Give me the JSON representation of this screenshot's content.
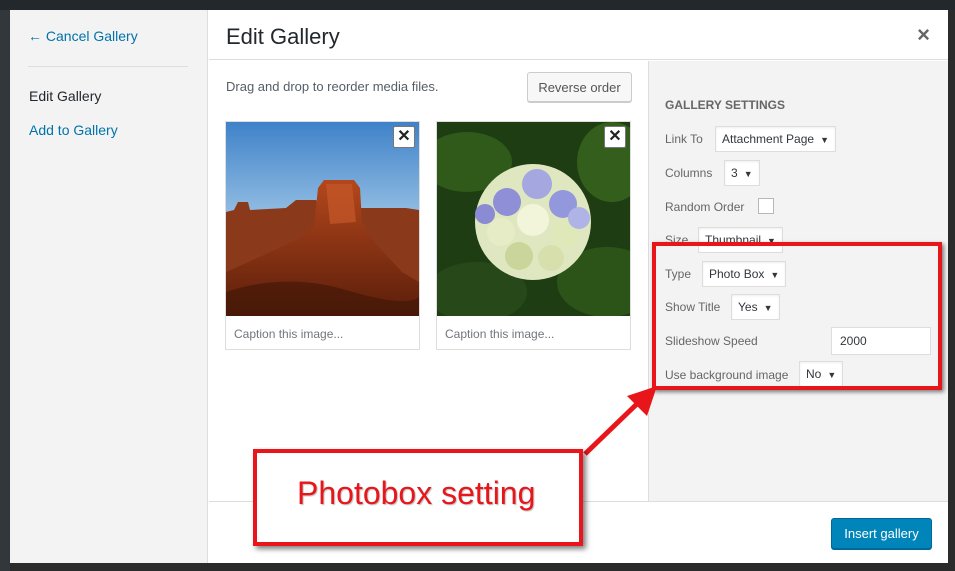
{
  "menu": {
    "cancel": "← Cancel Gallery",
    "edit": "Edit Gallery",
    "add": "Add to Gallery"
  },
  "header": {
    "title": "Edit Gallery",
    "close": "×"
  },
  "content": {
    "instructions": "Drag and drop to reorder media files.",
    "reverse_label": "Reverse order",
    "attachments": [
      {
        "caption": "Caption this image...",
        "remove": "✕"
      },
      {
        "caption": "Caption this image...",
        "remove": "✕"
      }
    ]
  },
  "settings": {
    "heading": "Gallery Settings",
    "link_to": {
      "label": "Link To",
      "value": "Attachment Page"
    },
    "columns": {
      "label": "Columns",
      "value": "3"
    },
    "random_order": {
      "label": "Random Order",
      "checked": false
    },
    "size": {
      "label": "Size",
      "value": "Thumbnail"
    },
    "type": {
      "label": "Type",
      "value": "Photo Box"
    },
    "show_title": {
      "label": "Show Title",
      "value": "Yes"
    },
    "slideshow_speed": {
      "label": "Slideshow Speed",
      "value": "2000"
    },
    "use_bg": {
      "label": "Use background image",
      "value": "No"
    }
  },
  "toolbar": {
    "insert_label": "Insert gallery"
  },
  "annotation": {
    "callout": "Photobox setting",
    "color": "#e8161b"
  },
  "colors": {
    "primary_button": "#0085ba",
    "link": "#0073aa"
  }
}
